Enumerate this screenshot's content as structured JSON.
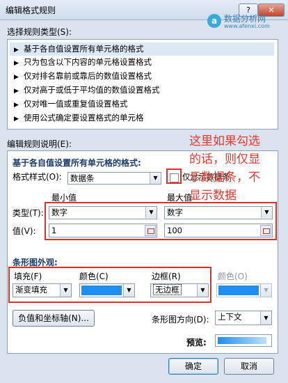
{
  "window": {
    "title": "编辑格式规则",
    "help": "?",
    "close": "✕"
  },
  "watermark": {
    "logo_letter": "a",
    "main": "数据分析网",
    "sub": "www.afenxi.com"
  },
  "rule_types": {
    "label": "选择规则类型(S):",
    "items": [
      {
        "label": "基于各自值设置所有单元格的格式"
      },
      {
        "label": "只为包含以下内容的单元格设置格式"
      },
      {
        "label": "仅对排名靠前或靠后的数值设置格式"
      },
      {
        "label": "仅对高于或低于平均值的数值设置格式"
      },
      {
        "label": "仅对唯一值或重复值设置格式"
      },
      {
        "label": "使用公式确定要设置格式的单元格"
      }
    ],
    "selected_index": 0
  },
  "description": {
    "label": "编辑规则说明(E):",
    "heading": "基于各自值设置所有单元格的格式:",
    "format_style_label": "格式样式(O):",
    "format_style_value": "数据条",
    "show_bar_only_label": "仅显示数据条",
    "show_bar_only_checked": false,
    "min_header": "最小值",
    "max_header": "最大值",
    "type_label": "类型(T):",
    "value_label": "值(V):",
    "min_type": "数字",
    "max_type": "数字",
    "min_value": "1",
    "max_value": "100"
  },
  "annotation": {
    "lines": [
      "这里如果勾选",
      "的话，则仅显",
      "示数据条，不",
      "显示数据"
    ]
  },
  "bar_appearance": {
    "heading": "条形图外观:",
    "fill_label": "填充(F)",
    "fill_value": "渐变填充",
    "color_label": "颜色(C)",
    "border_label": "边框(R)",
    "border_value": "无边框",
    "border_color_label": "颜色(O)",
    "bar_color": "#1e8ff0",
    "negative_axis_button": "负值和坐标轴(N)...",
    "direction_label": "条形图方向(D):",
    "direction_value": "上下文",
    "preview_label": "预览:"
  },
  "buttons": {
    "ok": "确定",
    "cancel": "取消"
  }
}
